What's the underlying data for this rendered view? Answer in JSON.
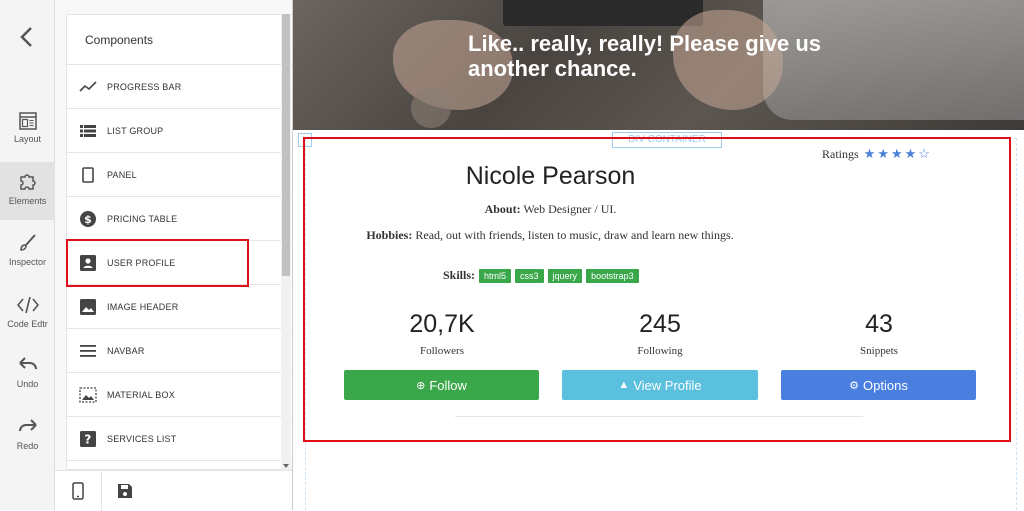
{
  "rail": {
    "items": [
      {
        "label": "Layout",
        "icon": "layout-icon"
      },
      {
        "label": "Elements",
        "icon": "puzzle-icon"
      },
      {
        "label": "Inspector",
        "icon": "brush-icon"
      },
      {
        "label": "Code Edtr",
        "icon": "code-icon"
      },
      {
        "label": "Undo",
        "icon": "undo-icon"
      },
      {
        "label": "Redo",
        "icon": "redo-icon"
      }
    ]
  },
  "panel": {
    "title": "Components",
    "items": [
      {
        "label": "PROGRESS BAR",
        "icon": "trend-line-icon"
      },
      {
        "label": "LIST GROUP",
        "icon": "list-icon"
      },
      {
        "label": "PANEL",
        "icon": "panel-icon"
      },
      {
        "label": "PRICING TABLE",
        "icon": "dollar-icon"
      },
      {
        "label": "USER PROFILE",
        "icon": "user-card-icon"
      },
      {
        "label": "IMAGE HEADER",
        "icon": "image-icon"
      },
      {
        "label": "NAVBAR",
        "icon": "menu-icon"
      },
      {
        "label": "MATERIAL BOX",
        "icon": "material-box-icon"
      },
      {
        "label": "SERVICES LIST",
        "icon": "help-icon"
      }
    ]
  },
  "hero": {
    "headline": "Like.. really, really! Please give us another chance."
  },
  "container_label": "DIV CONTAINER",
  "profile": {
    "ratings_label": "Ratings",
    "rating": 4,
    "rating_max": 5,
    "name": "Nicole Pearson",
    "about_label": "About:",
    "about": "Web Designer / UI.",
    "hobbies_label": "Hobbies:",
    "hobbies": "Read, out with friends, listen to music, draw and learn new things.",
    "skills_label": "Skills:",
    "skills": [
      "html5",
      "css3",
      "jquery",
      "bootstrap3"
    ],
    "stats": [
      {
        "value": "20,7K",
        "label": "Followers"
      },
      {
        "value": "245",
        "label": "Following"
      },
      {
        "value": "43",
        "label": "Snippets"
      }
    ],
    "buttons": [
      {
        "label": "Follow",
        "color": "#3aa84a"
      },
      {
        "label": "View Profile",
        "color": "#5bc0de"
      },
      {
        "label": "Options",
        "color": "#4a7fe0"
      }
    ]
  }
}
